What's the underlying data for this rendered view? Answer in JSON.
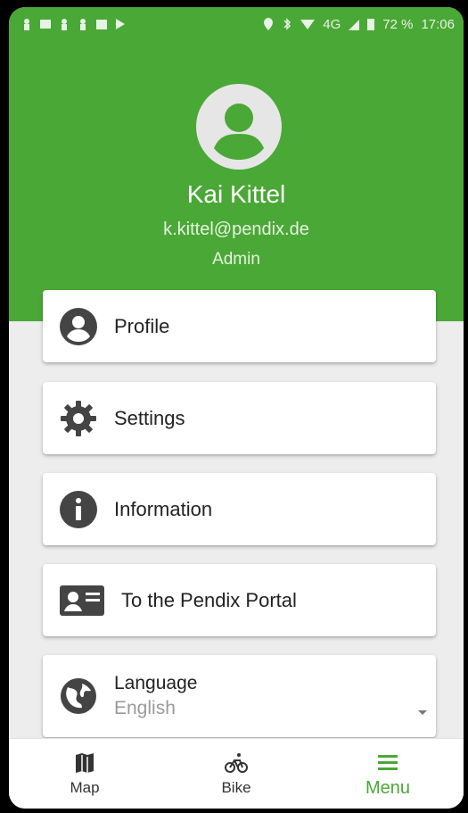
{
  "status_bar": {
    "battery": "72 %",
    "time": "17:06",
    "network": "4G"
  },
  "user": {
    "name": "Kai Kittel",
    "email": "k.kittel@pendix.de",
    "role": "Admin"
  },
  "menu": [
    {
      "label": "Profile",
      "icon": "account-circle-icon"
    },
    {
      "label": "Settings",
      "icon": "gear-icon"
    },
    {
      "label": "Information",
      "icon": "info-icon"
    },
    {
      "label": "To the Pendix Portal",
      "icon": "id-card-icon"
    }
  ],
  "language": {
    "title": "Language",
    "value": "English",
    "icon": "globe-icon"
  },
  "bottom_nav": [
    {
      "label": "Map",
      "icon": "map-icon",
      "active": false
    },
    {
      "label": "Bike",
      "icon": "bicycle-icon",
      "active": false
    },
    {
      "label": "Menu",
      "icon": "hamburger-menu-icon",
      "active": true
    }
  ],
  "colors": {
    "primary": "#4aa836",
    "background": "#ededed",
    "icon": "#444444"
  }
}
